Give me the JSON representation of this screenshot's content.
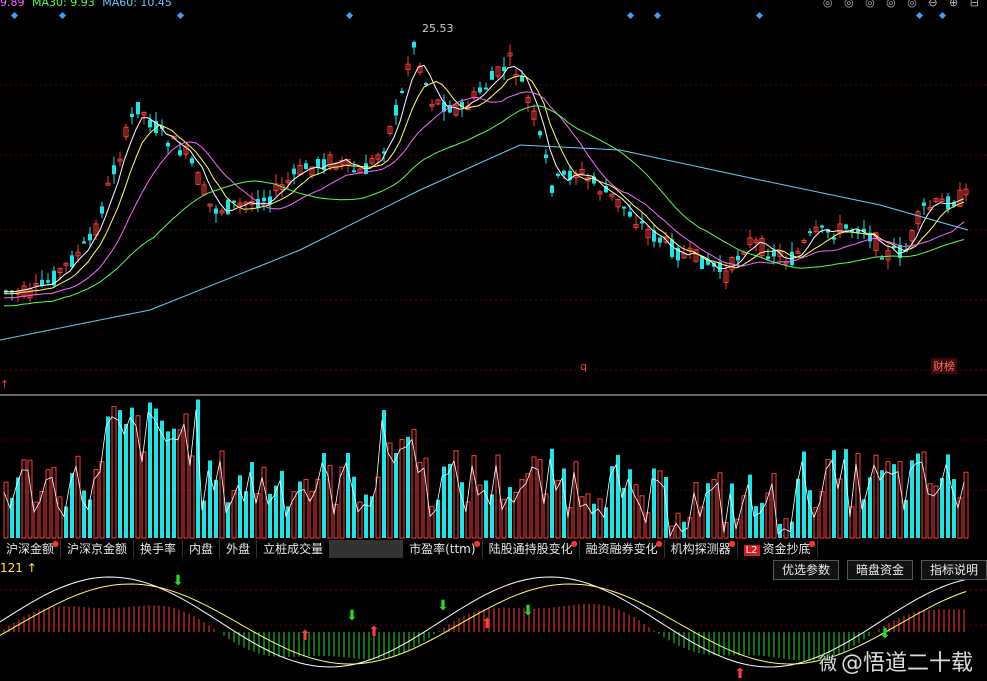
{
  "legend": {
    "ma_items": [
      {
        "label": "9.89",
        "color": "#ff66ff"
      },
      {
        "label": "MA30: 9.93",
        "color": "#55ff55"
      },
      {
        "label": "MA60: 10.45",
        "color": "#66ccff"
      }
    ]
  },
  "top_icons": "◎ ◎ ◎ ◎ ◎ ⊖ ⊕ ⊟",
  "price_panel": {
    "peak_label": "25.53",
    "q_marker": "q",
    "caibang_label": "财榜",
    "left_marker": "↑"
  },
  "tabs": [
    {
      "label": "沪深金额",
      "dot": true
    },
    {
      "label": "沪深京金额",
      "dot": false
    },
    {
      "label": "换手率",
      "dot": false
    },
    {
      "label": "内盘",
      "dot": false
    },
    {
      "label": "外盘",
      "dot": false
    },
    {
      "label": "立桩成交量",
      "dot": false
    },
    {
      "label": "",
      "blur": true
    },
    {
      "label": "市盈率(ttm)",
      "dot": true
    },
    {
      "label": "陆股通持股变化",
      "dot": true
    },
    {
      "label": "融资融券变化",
      "dot": true
    },
    {
      "label": "机构探测器",
      "dot": true
    },
    {
      "label": "资金抄底",
      "dot": true,
      "l2": "L2"
    }
  ],
  "indicator": {
    "label": "121 ↑",
    "buttons": [
      "优选参数",
      "暗盘资金",
      "指标说明"
    ]
  },
  "watermark": {
    "handle": "@悟道二十载",
    "logo": "微"
  },
  "colors": {
    "up": "#ff3b3b",
    "down": "#1be5e5",
    "grid": "#5a0000"
  }
}
